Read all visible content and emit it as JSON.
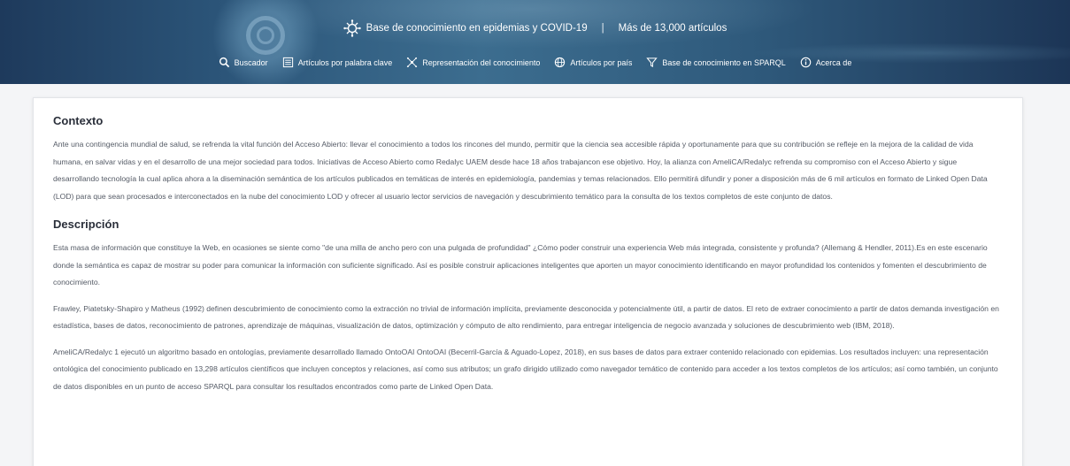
{
  "header": {
    "title": "Base de conocimiento en epidemias y COVID-19",
    "separator": "|",
    "count_text": "Más de 13,000 artículos"
  },
  "nav": [
    {
      "label": "Buscador",
      "icon": "search-icon"
    },
    {
      "label": "Artículos por palabra clave",
      "icon": "list-icon"
    },
    {
      "label": "Representación del conocimiento",
      "icon": "network-icon"
    },
    {
      "label": "Artículos por país",
      "icon": "globe-icon"
    },
    {
      "label": "Base de conocimiento en SPARQL",
      "icon": "filter-icon"
    },
    {
      "label": "Acerca de",
      "icon": "info-icon"
    }
  ],
  "sections": [
    {
      "title": "Contexto",
      "paragraphs": [
        "Ante una contingencia mundial de salud, se refrenda la vital función del Acceso Abierto: llevar el conocimiento a todos los rincones del mundo, permitir que la ciencia sea accesible rápida y oportunamente para que su contribución se refleje en la mejora de la calidad de vida humana, en salvar vidas y en el desarrollo de una mejor sociedad para todos. Iniciativas de Acceso Abierto como Redalyc UAEM desde hace 18 años trabajancon ese objetivo. Hoy, la alianza con AmeliCA/Redalyc refrenda su compromiso con el Acceso Abierto y sigue desarrollando tecnología la cual aplica ahora a la diseminación semántica de los artículos publicados en temáticas de interés en epidemiología, pandemias y temas relacionados. Ello permitirá difundir y poner a disposición más de 6 mil artículos en formato de Linked Open Data (LOD) para que sean procesados e interconectados en la nube del conocimiento LOD y ofrecer al usuario lector servicios de navegación y descubrimiento temático para la consulta de los textos completos de este conjunto de datos."
      ]
    },
    {
      "title": "Descripción",
      "paragraphs": [
        "Esta masa de información que constituye la Web, en ocasiones se siente como \"de una milla de ancho pero con una pulgada de profundidad\" ¿Cómo poder construir una experiencia Web más integrada, consistente y profunda? (Allemang & Hendler, 2011).Es en este escenario donde la semántica es capaz de mostrar su poder para comunicar la información con suficiente significado. Así es posible construir aplicaciones inteligentes que aporten un mayor conocimiento identificando en mayor profundidad los contenidos y fomenten el descubrimiento de conocimiento.",
        "Frawley, Piatetsky-Shapiro y Matheus (1992) definen descubrimiento de conocimiento como la extracción no trivial de información implícita, previamente desconocida y potencialmente útil, a partir de datos. El reto de extraer conocimiento a partir de datos demanda investigación en estadística, bases de datos, reconocimiento de patrones, aprendizaje de máquinas, visualización de datos, optimización y cómputo de alto rendimiento, para entregar inteligencia de negocio avanzada y soluciones de descubrimiento web (IBM, 2018).",
        "AmeliCA/Redalyc 1 ejecutó un algoritmo basado en ontologías, previamente desarrollado llamado OntoOAI OntoOAI (Becerril-García & Aguado-Lopez, 2018), en sus bases de datos para extraer contenido relacionado con epidemias. Los resultados incluyen: una representación ontológica del conocimiento publicado en 13,298 artículos científicos que incluyen conceptos y relaciones, así como sus atributos; un grafo dirigido utilizado como navegador temático de contenido para acceder a los textos completos de los artículos; así como también, un conjunto de datos disponibles en un punto de acceso SPARQL para consultar los resultados encontrados como parte de Linked Open Data."
      ]
    }
  ]
}
